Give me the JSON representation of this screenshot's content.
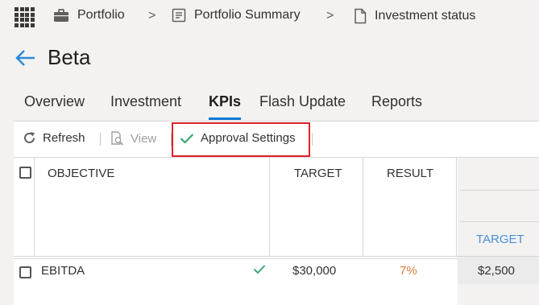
{
  "breadcrumb": [
    {
      "label": "Portfolio",
      "icon": "briefcase-icon"
    },
    {
      "label": "Portfolio Summary",
      "icon": "summary-doc-icon"
    },
    {
      "label": "Investment status",
      "icon": "page-icon"
    }
  ],
  "separator": ">",
  "page": {
    "title": "Beta"
  },
  "tabs": [
    {
      "label": "Overview",
      "active": false
    },
    {
      "label": "Investment",
      "active": false
    },
    {
      "label": "KPIs",
      "active": true
    },
    {
      "label": "Flash Update",
      "active": false
    },
    {
      "label": "Reports",
      "active": false
    }
  ],
  "commands": {
    "refresh": "Refresh",
    "view": "View",
    "approval": "Approval Settings"
  },
  "table": {
    "headers": {
      "objective": "OBJECTIVE",
      "target": "TARGET",
      "result": "RESULT",
      "sub_target": "TARGET"
    },
    "rows": [
      {
        "objective": "EBITDA",
        "approved": true,
        "target": "$30,000",
        "result": "7%",
        "sub_target": "$2,500"
      }
    ]
  },
  "colors": {
    "accent": "#0078d4",
    "result_orange": "#e07b39",
    "check_green": "#3aa76d",
    "highlight_red": "#e0202a",
    "link_blue": "#4a90d9"
  }
}
